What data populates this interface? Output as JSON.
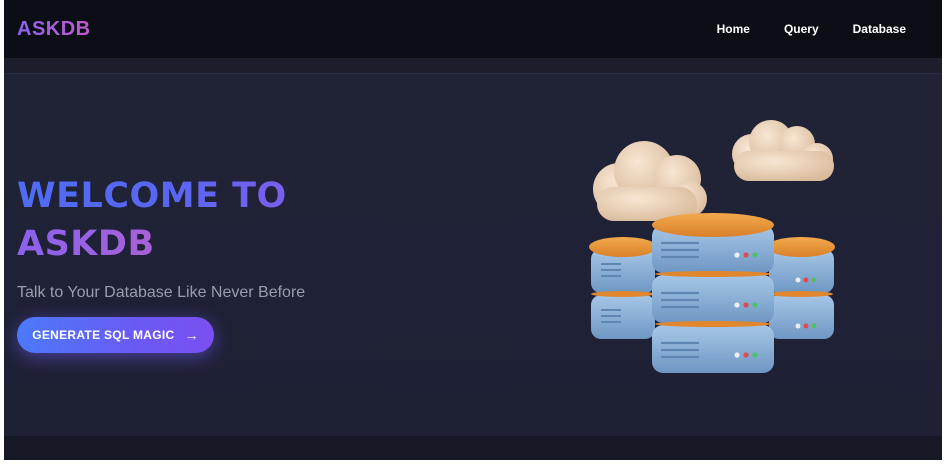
{
  "brand": {
    "name": "ASKDB"
  },
  "nav": {
    "items": [
      {
        "label": "Home"
      },
      {
        "label": "Query"
      },
      {
        "label": "Database"
      }
    ]
  },
  "hero": {
    "title_line1": "WELCOME TO",
    "title_line2": "ASKDB",
    "subtitle": "Talk to Your Database Like Never Before",
    "cta_label": "GENERATE SQL MAGIC",
    "cta_icon": "arrow-right-icon",
    "illustration": "database-servers-with-clouds"
  },
  "colors": {
    "background": "#1d1f33",
    "navbar": "#0c0e16",
    "accent_blue": "#4f6cf4",
    "accent_purple": "#8a62ee",
    "accent_pink": "#c45fc2",
    "server_body": "#8eb2d8",
    "server_top": "#ef9a3c",
    "cloud": "#efd9c3"
  }
}
